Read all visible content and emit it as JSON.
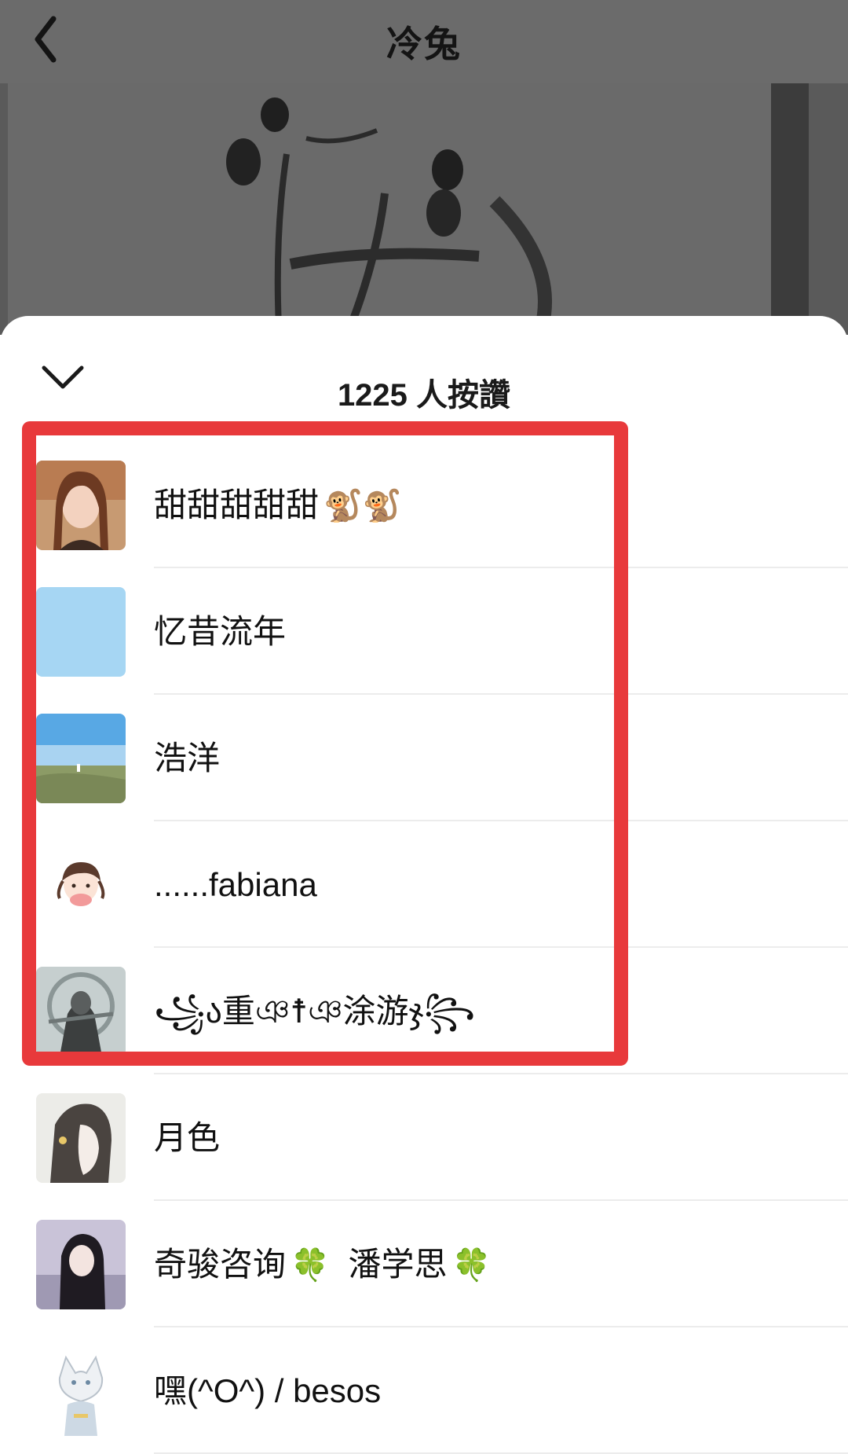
{
  "header": {
    "title": "冷兔"
  },
  "sheet": {
    "likes_title": "1225 人按讚"
  },
  "list": {
    "items": [
      {
        "name": "甜甜甜甜甜",
        "emoji": "🐒🐒",
        "avatar": "photo-girl-avatar"
      },
      {
        "name": "忆昔流年",
        "emoji": "",
        "avatar": "light-blue-avatar"
      },
      {
        "name": "浩洋",
        "emoji": "",
        "avatar": "landscape-avatar"
      },
      {
        "name": "......fabiana",
        "emoji": "",
        "avatar": "cartoon-girl-avatar"
      },
      {
        "name": "꧁ა重ঞ☨ঞ涂游ჯ꧂",
        "emoji": "",
        "avatar": "warrior-avatar"
      },
      {
        "name": "月色",
        "emoji": "",
        "avatar": "anime-girl-avatar"
      },
      {
        "name": "奇骏咨询",
        "emoji": "🍀",
        "name2": "潘学思",
        "emoji2": "🍀",
        "avatar": "portrait-girl-avatar"
      },
      {
        "name": "嘿(^O^) / besos",
        "emoji": "",
        "avatar": "white-cat-anime-avatar"
      }
    ]
  },
  "colors": {
    "highlight": "#e8393b",
    "header_dim": "#6b6b6b"
  }
}
